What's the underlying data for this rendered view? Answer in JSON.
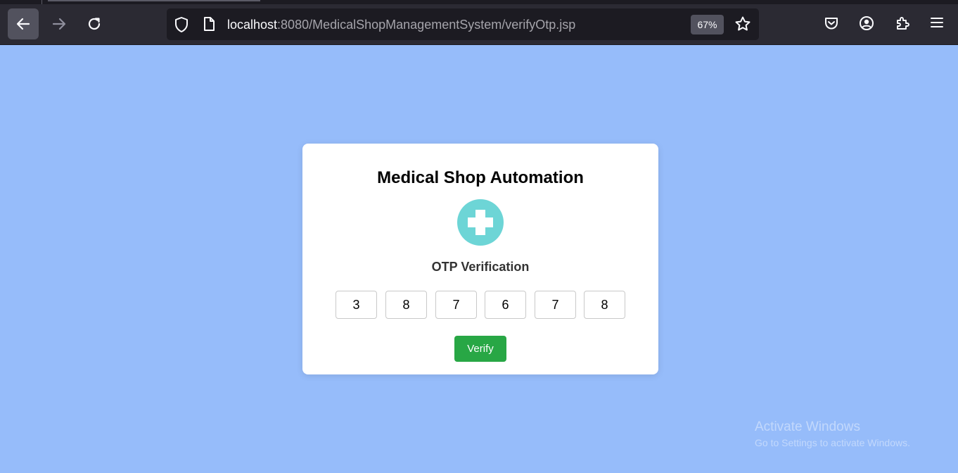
{
  "browser": {
    "url_host": "localhost",
    "url_rest": ":8080/MedicalShopManagementSystem/verifyOtp.jsp",
    "zoom": "67%",
    "icons": {
      "back": "back-arrow-icon",
      "forward": "forward-arrow-icon",
      "reload": "reload-icon",
      "shield": "tracking-protection-shield-icon",
      "page": "page-info-icon",
      "bookmark": "bookmark-star-icon",
      "pocket": "pocket-icon",
      "account": "account-icon",
      "extensions": "extensions-icon",
      "menu": "hamburger-menu-icon"
    }
  },
  "page": {
    "background_color": "#96bcfa",
    "title": "Medical Shop Automation",
    "logo_icon": "medical-cross-icon",
    "logo_color": "#6dd5d6",
    "subtitle": "OTP Verification",
    "otp_digits": [
      "3",
      "8",
      "7",
      "6",
      "7",
      "8"
    ],
    "verify_label": "Verify",
    "verify_color": "#28a745"
  },
  "watermark": {
    "title": "Activate Windows",
    "subtitle": "Go to Settings to activate Windows."
  }
}
